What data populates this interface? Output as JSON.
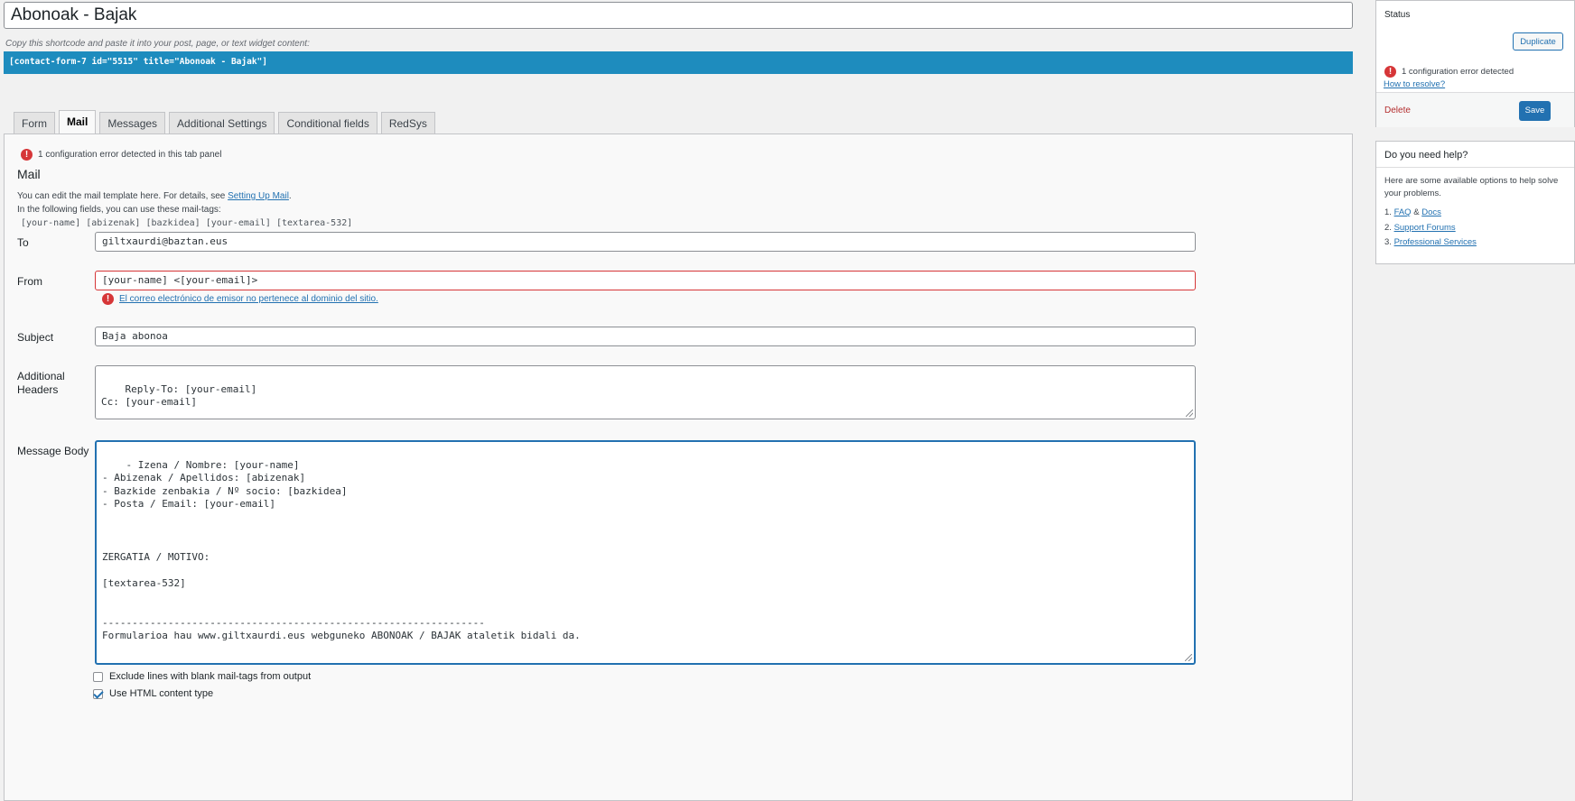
{
  "form": {
    "title": "Abonoak - Bajak",
    "shortcode_hint": "Copy this shortcode and paste it into your post, page, or text widget content:",
    "shortcode": "[contact-form-7 id=\"5515\" title=\"Abonoak - Bajak\"]"
  },
  "tabs": [
    {
      "label": "Form",
      "active": false
    },
    {
      "label": "Mail",
      "active": true
    },
    {
      "label": "Messages",
      "active": false
    },
    {
      "label": "Additional Settings",
      "active": false
    },
    {
      "label": "Conditional fields",
      "active": false
    },
    {
      "label": "RedSys",
      "active": false
    }
  ],
  "mail": {
    "tab_error": "1 configuration error detected in this tab panel",
    "heading": "Mail",
    "desc_prefix": "You can edit the mail template here. For details, see ",
    "desc_link": "Setting Up Mail",
    "desc_suffix": ".",
    "desc_line2": "In the following fields, you can use these mail-tags:",
    "mail_tags": "[your-name] [abizenak] [bazkidea] [your-email] [textarea-532]",
    "to": {
      "label": "To",
      "value": "giltxaurdi@baztan.eus"
    },
    "from": {
      "label": "From",
      "value": "[your-name] <[your-email]>",
      "error": "El correo electrónico de emisor no pertenece al dominio del sitio."
    },
    "subject": {
      "label": "Subject",
      "value": "Baja abonoa"
    },
    "headers": {
      "label_line1": "Additional",
      "label_line2": "Headers",
      "value": "Reply-To: [your-email]\nCc: [your-email]"
    },
    "body": {
      "label": "Message Body",
      "value": "- Izena / Nombre: [your-name]\n- Abizenak / Apellidos: [abizenak]\n- Bazkide zenbakia / Nº socio: [bazkidea]\n- Posta / Email: [your-email]\n\n\n\nZERGATIA / MOTIVO:\n\n[textarea-532]\n\n\n----------------------------------------------------------------\nFormularioa hau www.giltxaurdi.eus webguneko ABONOAK / BAJAK ataletik bidali da."
    },
    "exclude_blank": {
      "label": "Exclude lines with blank mail-tags from output",
      "checked": false
    },
    "use_html": {
      "label": "Use HTML content type",
      "checked": true
    }
  },
  "sidebar": {
    "status": {
      "title": "Status",
      "duplicate": "Duplicate",
      "error": "1 configuration error detected",
      "how_to": "How to resolve?",
      "delete": "Delete",
      "save": "Save"
    },
    "help": {
      "title": "Do you need help?",
      "desc": "Here are some available options to help solve your problems.",
      "faq": "FAQ",
      "amp": " & ",
      "docs": "Docs",
      "forums": "Support Forums",
      "services": "Professional Services"
    }
  },
  "colors": {
    "accent": "#2271b1",
    "shortcode_bar": "#1e8cbe",
    "error": "#d63638"
  }
}
